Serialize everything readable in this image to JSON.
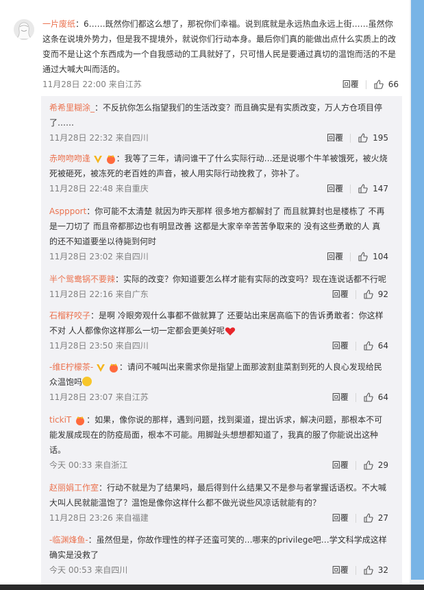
{
  "main_comment": {
    "author": "一片废纸",
    "text": "：6……既然你们都这么想了，那祝你们幸福。说到底就是永远热血永远上街……虽然你这条在说境外势力，但是我不提境外，就说你们行动本身。最后你们真的能做出点什么实质上的改变而不是让这个东西成为一个自我感动的工具就好了，只可惜人民是要通过真切的温饱而活的不是通过大喊大叫而活的。",
    "time": "11月28日 22:00 来自江苏",
    "reply_label": "回覆",
    "likes": "66"
  },
  "replies": [
    {
      "author": "希希里糊涂_",
      "text": "：不反抗你怎么指望我们的生活改变？而且确实是有实质改变，万人方仓项目停了……",
      "time": "11月28日 22:32 来自四川",
      "reply_label": "回覆",
      "likes": "195"
    },
    {
      "author": "赤吻吻吻逢",
      "text": "：我等了三年，请问谁干了什么实际行动…还是说哪个牛羊被饿死，被火烧死被砸死，被冻死的老百姓的声音，被人用实际行动挽救了，弥补了。",
      "time": "11月28日 22:48 来自重庆",
      "reply_label": "回覆",
      "likes": "147"
    },
    {
      "author": "Asppport",
      "text": "：你可能不太清楚 就因为昨天那样 很多地方都解封了 而且就算封也是楼栋了 不再是一刀切了 而且帝都那边也有明显改善 这都是大家辛辛苦苦争取来的 没有这些勇敢的人 真的还不知道要坐以待毙到何时",
      "time": "11月28日 23:02 来自四川",
      "reply_label": "回覆",
      "likes": "104"
    },
    {
      "author": "半个鸳鸯锅不要辣",
      "text": "：实际的改变？你知道要怎么样才能有实际的改变吗？现在连说话都不行呢",
      "time": "11月28日 22:16 来自广东",
      "reply_label": "回覆",
      "likes": "92"
    },
    {
      "author": "石榴籽咬子",
      "text": "：是啊 冷眼旁观什么事都不做就算了 还要站出来居高临下的告诉勇敢者：你这样不对 人人都像你这样那么一切一定都会更美好呢",
      "time": "11月28日 23:50 来自四川",
      "reply_label": "回覆",
      "likes": "64"
    },
    {
      "author": "-维E柠檬茶-",
      "text": "：请问不喊叫出来需求你是指望上面那波割韭菜割到死的人良心发现给民众温饱吗",
      "time": "11月28日 23:07 来自江苏",
      "reply_label": "回覆",
      "likes": "64"
    },
    {
      "author": "tickiT",
      "text": "：如果，像你说的那样，遇到问题，找到渠道，提出诉求，解决问题，那根本不可能发展成现在的防疫局面，根本不可能。用脚趾头想想都知道了，我真的服了你能说出这种话。",
      "time": "今天 00:33 来自浙江",
      "reply_label": "回覆",
      "likes": "29"
    },
    {
      "author": "赵丽娟工作室",
      "text": "：行动不就是为了结果吗，最后得到什么结果又不是参与者掌握话语权。不大喊大叫人民就能温饱了？温饱是像你这样什么都不做光说些风凉话就能有的？",
      "time": "11月28日 23:26 来自福建",
      "reply_label": "回覆",
      "likes": "27"
    },
    {
      "author": "-临渊烽鱼-",
      "text": "：虽然但是，你故作理性的样子还蛮可笑的…哪来的privilege吧…学文科学成这样确实是没救了",
      "time": "今天 00:53 来自四川",
      "reply_label": "回覆",
      "likes": "32"
    }
  ],
  "colors": {
    "name": "#eb7350",
    "meta": "#808080",
    "reply_bg": "#f2f2f5",
    "scroll_track": "#78b4e6",
    "vip_badge": "#f5b51b"
  },
  "icons": {
    "like": "thumbs-up-icon",
    "vip": "vip-v-badge-icon",
    "fan": "fan-crown-badge-icon",
    "heart": "red-heart-emoji",
    "hug": "hug-emoji"
  }
}
